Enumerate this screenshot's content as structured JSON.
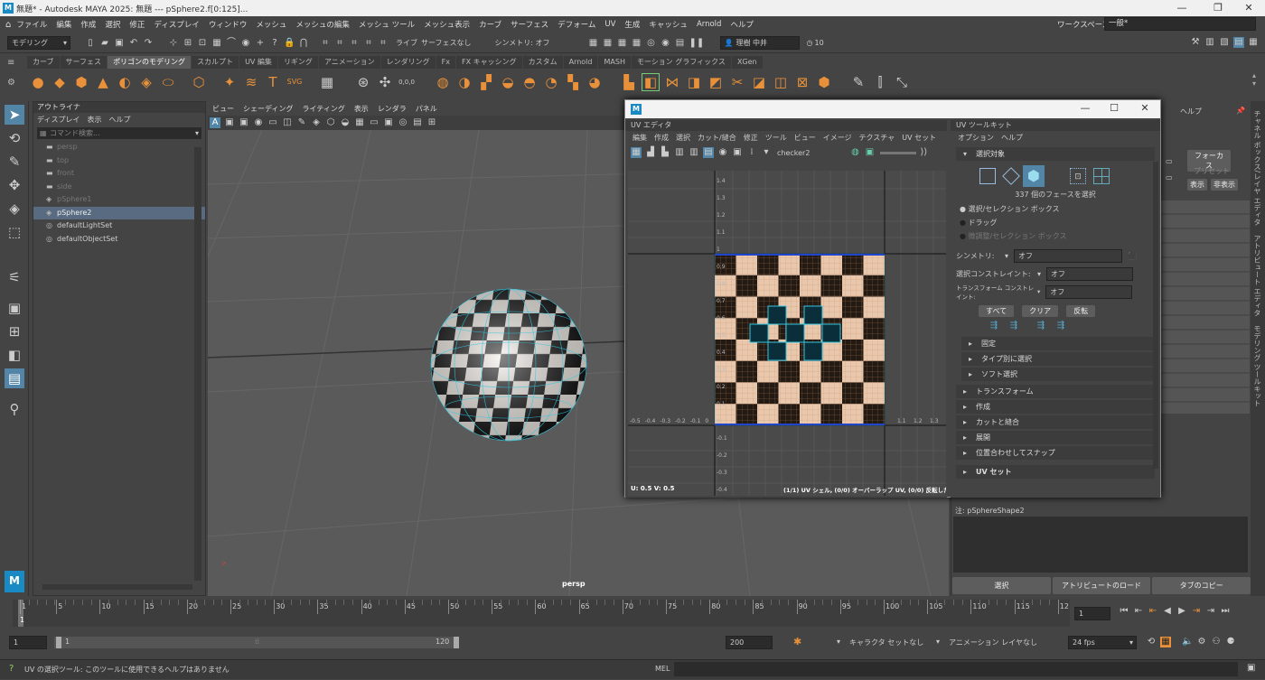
{
  "window": {
    "title": "無題* - Autodesk MAYA 2025: 無題  ---  pSphere2.f[0:125]...",
    "workspace_label": "ワークスペース :",
    "workspace_value": "一般*",
    "logo": "M"
  },
  "menus": [
    "ファイル",
    "編集",
    "作成",
    "選択",
    "修正",
    "ディスプレイ",
    "ウィンドウ",
    "メッシュ",
    "メッシュの編集",
    "メッシュ ツール",
    "メッシュ表示",
    "カーブ",
    "サーフェス",
    "デフォーム",
    "UV",
    "生成",
    "キャッシュ",
    "Arnold",
    "ヘルプ"
  ],
  "status": {
    "mode": "モデリング",
    "live": "ライブ",
    "live_surface": "サーフェスなし",
    "symmetry": "シンメトリ: オフ",
    "user": "理樹 中井",
    "clock": "10"
  },
  "shelf_tabs": [
    {
      "label": "カーブ",
      "active": false
    },
    {
      "label": "サーフェス",
      "active": false
    },
    {
      "label": "ポリゴンのモデリング",
      "active": true
    },
    {
      "label": "スカルプト",
      "active": false
    },
    {
      "label": "UV 編集",
      "active": false
    },
    {
      "label": "リギング",
      "active": false
    },
    {
      "label": "アニメーション",
      "active": false
    },
    {
      "label": "レンダリング",
      "active": false
    },
    {
      "label": "Fx",
      "active": false
    },
    {
      "label": "FX キャッシング",
      "active": false
    },
    {
      "label": "カスタム",
      "active": false
    },
    {
      "label": "Arnold",
      "active": false
    },
    {
      "label": "MASH",
      "active": false
    },
    {
      "label": "モーション グラフィックス",
      "active": false
    },
    {
      "label": "XGen",
      "active": false
    }
  ],
  "outliner": {
    "title": "アウトライナ",
    "menus": [
      "ディスプレイ",
      "表示",
      "ヘルプ"
    ],
    "search_placeholder": "コマンド検索...",
    "items": [
      {
        "label": "persp",
        "state": "dim"
      },
      {
        "label": "top",
        "state": "dim"
      },
      {
        "label": "front",
        "state": "dim"
      },
      {
        "label": "side",
        "state": "dim"
      },
      {
        "label": "pSphere1",
        "state": "dim"
      },
      {
        "label": "pSphere2",
        "state": "sel"
      },
      {
        "label": "defaultLightSet",
        "state": "normal"
      },
      {
        "label": "defaultObjectSet",
        "state": "normal"
      }
    ]
  },
  "viewport": {
    "menus": [
      "ビュー",
      "シェーディング",
      "ライティング",
      "表示",
      "レンダラ",
      "パネル"
    ],
    "camera_label": "persp"
  },
  "uv_editor": {
    "tab": "UV エディタ",
    "menus": [
      "編集",
      "作成",
      "選択",
      "カット/縫合",
      "修正",
      "ツール",
      "ビュー",
      "イメージ",
      "テクスチャ",
      "UV セット"
    ],
    "texture": "checker2",
    "coords": "U:  0.5  V:  0.5",
    "info": "(1/1) UV シェル, (0/0) オーバーラップ UV, (0/0) 反転した UV",
    "v_ticks": [
      "1.4",
      "1.3",
      "1.2",
      "1.1",
      "1",
      "0.9",
      "0.8",
      "0.7",
      "0.6",
      "0.5",
      "0.4",
      "0.3",
      "0.2",
      "0.1",
      "0",
      "-0.1",
      "-0.2",
      "-0.3",
      "-0.4"
    ],
    "u_ticks_left": [
      "-0.5",
      "-0.4",
      "-0.3",
      "-0.2",
      "-0.1",
      "0"
    ],
    "u_ticks_right": [
      "1.1",
      "1.2",
      "1.3"
    ]
  },
  "uv_toolkit": {
    "tab": "UV ツールキット",
    "menus": [
      "オプション",
      "ヘルプ"
    ],
    "section_select": "選択対象",
    "face_count": "337 個のフェースを選択",
    "radio1": "選択/セレクション ボックス",
    "radio2": "ドラッグ",
    "radio3": "微調整/セレクション ボックス",
    "symmetry_label": "シンメトリ:",
    "symmetry_value": "オフ",
    "constraint_label": "選択コンストレイント:",
    "constraint_value": "オフ",
    "transform_constraint_label": "トランスフォーム コンストレイント:",
    "transform_constraint_value": "オフ",
    "btn_all": "すべて",
    "btn_clear": "クリア",
    "btn_invert": "反転",
    "subsections": [
      "固定",
      "タイプ別に選択",
      "ソフト選択"
    ],
    "sections": [
      "トランスフォーム",
      "作成",
      "カットと縫合",
      "展開",
      "位置合わせしてスナップ"
    ],
    "uvset": "UV セット"
  },
  "right_panel": {
    "focus": "フォーカス",
    "preset": "プリセット",
    "show": "表示",
    "hide": "非表示",
    "help_menu": "ヘルプ",
    "note": "注:  pSphereShape2",
    "btn_select": "選択",
    "btn_load": "アトリビュートのロード",
    "btn_copy": "タブのコピー"
  },
  "vertical_tabs": [
    "チャネル ボックス/レイヤ エディタ",
    "アトリビュート エディタ",
    "モデリング ツールキット"
  ],
  "timeline": {
    "ticks": [
      "1",
      "5",
      "10",
      "15",
      "20",
      "25",
      "30",
      "35",
      "40",
      "45",
      "50",
      "55",
      "60",
      "65",
      "70",
      "75",
      "80",
      "85",
      "90",
      "95",
      "100",
      "105",
      "110",
      "115",
      "12"
    ],
    "current_frame": "1",
    "range_start": "1",
    "range_inner_start": "1",
    "range_inner_end": "120",
    "range_end": "200",
    "character_set": "キャラクタ セットなし",
    "anim_layer": "アニメーション レイヤなし",
    "fps": "24 fps"
  },
  "command_line": {
    "help_text": "UV の選択ツール: このツールに使用できるヘルプはありません",
    "lang": "MEL"
  },
  "colors": {
    "accent": "#5285a6",
    "shelf_icon": "#e8913a",
    "uv_wire": "#35c6e0",
    "title_bar": "#f0f0f0"
  }
}
